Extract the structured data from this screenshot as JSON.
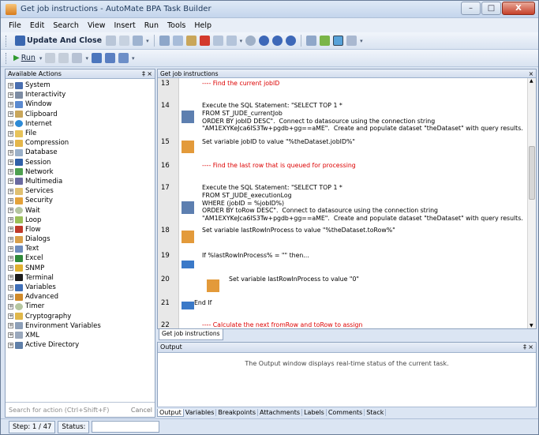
{
  "window": {
    "title": "Get job instructions - AutoMate BPA Task Builder",
    "minimize": "–",
    "maximize": "□",
    "close": "X"
  },
  "menu": [
    "File",
    "Edit",
    "Search",
    "View",
    "Insert",
    "Run",
    "Tools",
    "Help"
  ],
  "toolbar": {
    "update_and_close": "Update And Close",
    "run": "Run"
  },
  "left_panel": {
    "title": "Available Actions",
    "pin": "‡",
    "close": "×",
    "items": [
      "System",
      "Interactivity",
      "Window",
      "Clipboard",
      "Internet",
      "File",
      "Compression",
      "Database",
      "Session",
      "Network",
      "Multimedia",
      "Services",
      "Security",
      "Wait",
      "Loop",
      "Flow",
      "Dialogs",
      "Text",
      "Excel",
      "SNMP",
      "Terminal",
      "Variables",
      "Advanced",
      "Timer",
      "Cryptography",
      "Environment Variables",
      "XML",
      "Active Directory"
    ],
    "search_placeholder": "Search for action (Ctrl+Shift+F)",
    "cancel": "Cancel"
  },
  "editor": {
    "title": "Get job instructions",
    "close": "×",
    "lines": [
      {
        "num": "13",
        "text": "---- Find the current jobID"
      },
      {
        "num": "14",
        "text": "Execute the SQL Statement: \"SELECT TOP 1 *\nFROM ST_JUDE_currentJob\nORDER BY jobID DESC\".  Connect to datasource using the connection string\n\"AM1EXYKeJca6IS3Tw+pgdb+gg==aME\".  Create and populate dataset \"theDataset\" with query results."
      },
      {
        "num": "15",
        "text": "Set variable jobID to value \"%theDataset.jobID%\""
      },
      {
        "num": "16",
        "text": "---- Find the last row that is queued for processing"
      },
      {
        "num": "17",
        "text": "Execute the SQL Statement: \"SELECT TOP 1 *\nFROM ST_JUDE_executionLog\nWHERE (jobID = %jobID%)\nORDER BY toRow DESC\".  Connect to datasource using the connection string\n\"AM1EXYKeJca6IS3Tw+pgdb+gg==aME\".  Create and populate dataset \"theDataset\" with query results."
      },
      {
        "num": "18",
        "text": "Set variable lastRowInProcess to value \"%theDataset.toRow%\""
      },
      {
        "num": "19",
        "text": "If %lastRowInProcess% = \"\" then..."
      },
      {
        "num": "20",
        "text": "Set variable lastRowInProcess to value \"0\""
      },
      {
        "num": "21",
        "text": "End If"
      },
      {
        "num": "22",
        "text": "---- Calculate the next fromRow and toRow to assign"
      }
    ],
    "bottom_tab": "Get job instructions"
  },
  "output": {
    "title": "Output",
    "pin": "‡",
    "close": "×",
    "message": "The Output window displays real-time status of the current task.",
    "tabs": [
      "Output",
      "Variables",
      "Breakpoints",
      "Attachments",
      "Labels",
      "Comments",
      "Stack"
    ]
  },
  "status": {
    "step": "Step: 1 / 47",
    "status_label": "Status:"
  },
  "colors": {
    "accent": "#1e395b",
    "comment_red": "#dd0000"
  }
}
